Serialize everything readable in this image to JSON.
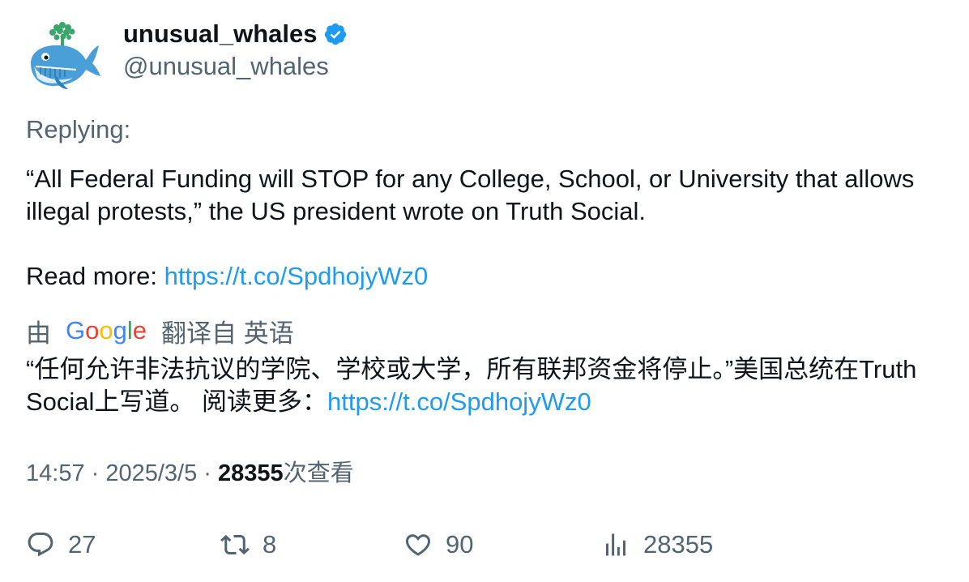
{
  "author": {
    "display_name": "unusual_whales",
    "handle": "@unusual_whales",
    "verified": true,
    "verified_icon": "verified-badge-icon",
    "avatar_icon": "whale-avatar"
  },
  "replying_label": "Replying:",
  "tweet": {
    "text_line": "“All Federal Funding will STOP for any College, School, or University that allows illegal protests,” the US president wrote on Truth Social.",
    "read_more_label": "Read more: ",
    "link": "https://t.co/SpdhojyWz0"
  },
  "translation": {
    "by_label": "由",
    "provider": "Google",
    "from_label": "翻译自 英语",
    "text": "“任何允许非法抗议的学院、学校或大学，所有联邦资金将停止。”美国总统在Truth Social上写道。 阅读更多：",
    "link": "https://t.co/SpdhojyWz0"
  },
  "meta": {
    "time": "14:57",
    "separator": " · ",
    "date": "2025/3/5",
    "views_count": "28355",
    "views_label": "次查看"
  },
  "actions": {
    "reply": {
      "icon": "reply-icon",
      "count": "27"
    },
    "retweet": {
      "icon": "retweet-icon",
      "count": "8"
    },
    "like": {
      "icon": "heart-icon",
      "count": "90"
    },
    "views": {
      "icon": "views-icon",
      "count": "28355"
    }
  },
  "colors": {
    "link": "#1d9bf0",
    "secondary_text": "#536471",
    "primary_text": "#0f1419",
    "verified": "#1d9bf0"
  }
}
